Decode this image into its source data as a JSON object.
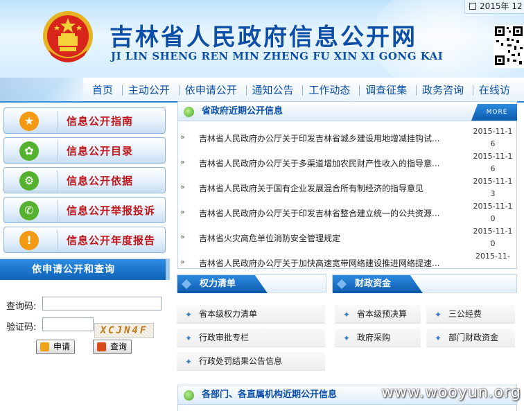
{
  "header": {
    "title": "吉林省人民政府信息公开网",
    "subtitle": "JI LIN SHENG REN MIN ZHENG FU XIN XI GONG KAI",
    "date": "2015年 12"
  },
  "nav": {
    "items": [
      "首页",
      "主动公开",
      "依申请公开",
      "通知公告",
      "工作动态",
      "调查征集",
      "政务咨询",
      "在线访"
    ]
  },
  "left_menu": [
    {
      "label": "信息公开指南",
      "icon": "star-icon",
      "color": "#f39a12"
    },
    {
      "label": "信息公开目录",
      "icon": "flower-icon",
      "color": "#54b22e"
    },
    {
      "label": "信息公开依据",
      "icon": "gear-icon",
      "color": "#54b22e"
    },
    {
      "label": "信息公开举报投诉",
      "icon": "phone-icon",
      "color": "#54b22e"
    },
    {
      "label": "信息公开年度报告",
      "icon": "exclamation-icon",
      "color": "#f39a12"
    }
  ],
  "apply": {
    "title": "依申请公开和查询",
    "query_label": "查询码:",
    "verify_label": "验证码:",
    "captcha_text": "XCJN4F",
    "apply_button": "申请",
    "query_button": "查询"
  },
  "news": {
    "title": "省政府近期公开信息",
    "more": "MORE",
    "items": [
      {
        "text": "吉林省人民政府办公厅关于印发吉林省城乡建设用地增减挂钩试...",
        "date": "2015-11-16"
      },
      {
        "text": "吉林省人民政府办公厅关于多渠道增加农民财产性收入的指导意...",
        "date": "2015-11-16"
      },
      {
        "text": "吉林省人民政府关于国有企业发展混合所有制经济的指导意见",
        "date": "2015-11-13"
      },
      {
        "text": "吉林省人民政府办公厅关于印发吉林省整合建立统一的公共资源...",
        "date": "2015-11-10"
      },
      {
        "text": "吉林省火灾高危单位消防安全管理规定",
        "date": "2015-11-10"
      },
      {
        "text": "吉林省人民政府办公厅关于加快高速宽带网络建设推进网络提速...",
        "date": "2015-11-"
      }
    ]
  },
  "power": {
    "title": "权力清单",
    "items": [
      "省本级权力清单",
      "行政审批专栏",
      "行政处罚结果公告信息"
    ]
  },
  "finance": {
    "title": "财政资金",
    "items": [
      "省本级预决算",
      "三公经费",
      "政府采购",
      "部门财政资金"
    ]
  },
  "dept": {
    "title": "各部门、各直属机构近期公开信息"
  },
  "watermark": "www.wooyun.org"
}
